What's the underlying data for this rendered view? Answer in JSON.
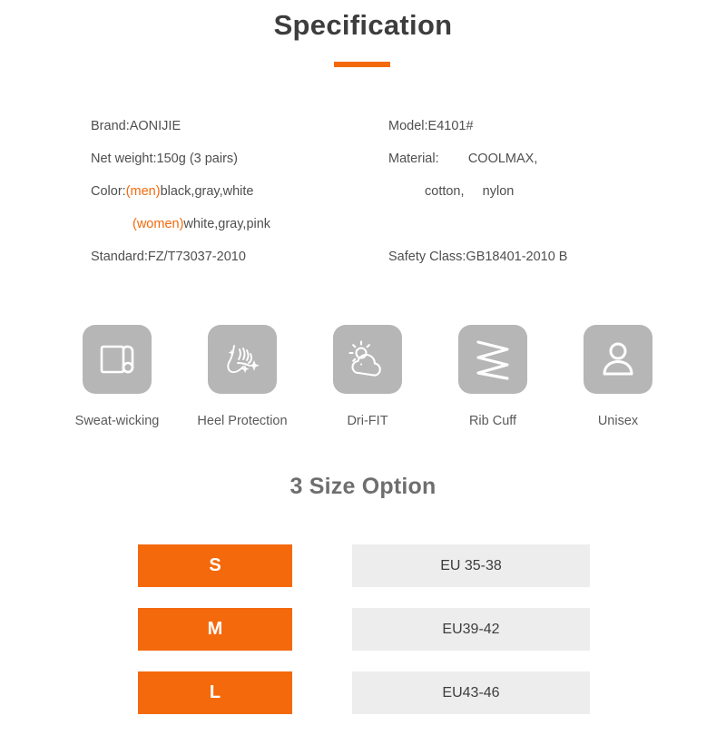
{
  "header": {
    "title": "Specification",
    "accent_color": "#f4690c"
  },
  "spec": {
    "left": [
      {
        "label": "Brand:AONIJIE"
      },
      {
        "label": "Net weight:150g (3 pairs)"
      },
      {
        "prefix": "Color:",
        "accent": "(men)",
        "suffix": "black,gray,white"
      },
      {
        "accent": "(women)",
        "suffix": "white,gray,pink",
        "indented": true
      },
      {
        "label": "Standard:FZ/T73037-2010"
      }
    ],
    "right": [
      {
        "label": "Model:E4101#"
      },
      {
        "label": "Material:        COOLMAX,"
      },
      {
        "label": "cotton,     nylon",
        "indented": true
      },
      {
        "label": ""
      },
      {
        "label": "Safety Class:GB18401-2010 B"
      }
    ]
  },
  "features": [
    {
      "label": "Sweat-wicking",
      "icon": "fabric-roll-icon"
    },
    {
      "label": "Heel Protection",
      "icon": "foot-sparkle-icon"
    },
    {
      "label": "Dri-FIT",
      "icon": "sun-cloud-icon"
    },
    {
      "label": "Rib Cuff",
      "icon": "zigzag-rib-icon"
    },
    {
      "label": "Unisex",
      "icon": "person-icon"
    }
  ],
  "sizes": {
    "title": "3 Size Option",
    "rows": [
      {
        "size": "S",
        "value": "EU 35-38"
      },
      {
        "size": "M",
        "value": "EU39-42"
      },
      {
        "size": "L",
        "value": "EU43-46"
      }
    ]
  }
}
